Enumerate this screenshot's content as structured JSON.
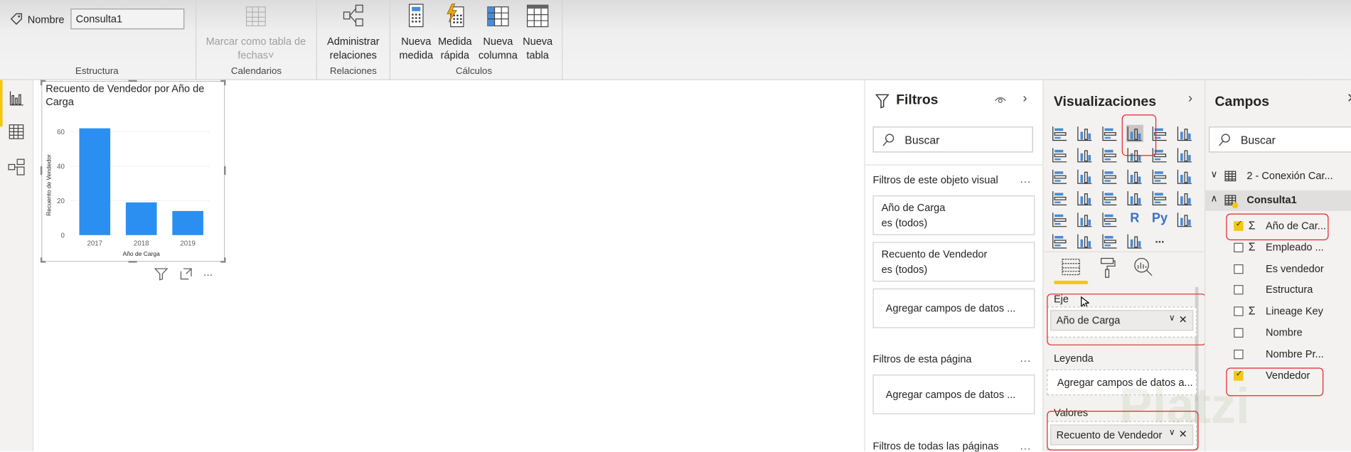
{
  "ribbon": {
    "name_label": "Nombre",
    "name_value": "Consulta1",
    "group_estructura": "Estructura",
    "mark_date_table": "Marcar como tabla de",
    "mark_date_table_2": "fechas",
    "group_calendarios": "Calendarios",
    "manage_rel_1": "Administrar",
    "manage_rel_2": "relaciones",
    "group_relaciones": "Relaciones",
    "new_measure_1": "Nueva",
    "new_measure_2": "medida",
    "quick_measure_1": "Medida",
    "quick_measure_2": "rápida",
    "new_column_1": "Nueva",
    "new_column_2": "columna",
    "new_table_1": "Nueva",
    "new_table_2": "tabla",
    "group_calculos": "Cálculos"
  },
  "chart_data": {
    "type": "bar",
    "title": "Recuento de Vendedor por Año de Carga",
    "categories": [
      "2017",
      "2018",
      "2019"
    ],
    "values": [
      62,
      19,
      14
    ],
    "xlabel": "Año de Carga",
    "ylabel": "Recuento de Vendedor",
    "yticks": [
      "0",
      "20",
      "40",
      "60"
    ],
    "ylim": [
      0,
      65
    ],
    "grid": true,
    "color": "#2b8ff2"
  },
  "filters": {
    "title": "Filtros",
    "search_placeholder": "Buscar",
    "visual_section": "Filtros de este objeto visual",
    "cards": [
      {
        "field": "Año de Carga",
        "state": "es (todos)"
      },
      {
        "field": "Recuento de Vendedor",
        "state": "es (todos)"
      }
    ],
    "add_fields": "Agregar campos de datos ...",
    "page_section": "Filtros de esta página",
    "page_add": "Agregar campos de datos ...",
    "all_section": "Filtros de todas las páginas",
    "more": "..."
  },
  "visualizations": {
    "title": "Visualizaciones",
    "icons": [
      "stacked-bar",
      "stacked-column",
      "clustered-bar",
      "clustered-column",
      "100-bar",
      "100-column",
      "line",
      "area",
      "stacked-area",
      "line-column",
      "line-clustered-column",
      "ribbon",
      "waterfall",
      "funnel",
      "scatter",
      "pie",
      "donut",
      "treemap",
      "map",
      "filled-map",
      "gauge",
      "card",
      "multirow-card",
      "kpi",
      "slicer",
      "table",
      "matrix",
      "r-visual",
      "python-visual",
      "key-influencers",
      "decomposition-tree",
      "qa",
      "arcgis",
      "power-apps",
      "more"
    ],
    "r_label": "R",
    "py_label": "Py",
    "more_label": "...",
    "axis_label": "Eje",
    "axis_value": "Año de Carga",
    "legend_label": "Leyenda",
    "legend_placeholder": "Agregar campos de datos a...",
    "values_label": "Valores",
    "values_value": "Recuento de Vendedor"
  },
  "fields": {
    "title": "Campos",
    "search_placeholder": "Buscar",
    "tables": [
      {
        "name": "2 - Conexión Car...",
        "expanded": false
      },
      {
        "name": "Consulta1",
        "expanded": true
      }
    ],
    "items": [
      {
        "label": "Año de Car...",
        "sigma": true,
        "checked": true
      },
      {
        "label": "Empleado ...",
        "sigma": true,
        "checked": false
      },
      {
        "label": "Es vendedor",
        "sigma": false,
        "checked": false
      },
      {
        "label": "Estructura",
        "sigma": false,
        "checked": false
      },
      {
        "label": "Lineage Key",
        "sigma": true,
        "checked": false
      },
      {
        "label": "Nombre",
        "sigma": false,
        "checked": false
      },
      {
        "label": "Nombre Pr...",
        "sigma": false,
        "checked": false
      },
      {
        "label": "Vendedor",
        "sigma": false,
        "checked": true
      }
    ],
    "sigma": "Σ"
  },
  "watermark": "Platzi"
}
